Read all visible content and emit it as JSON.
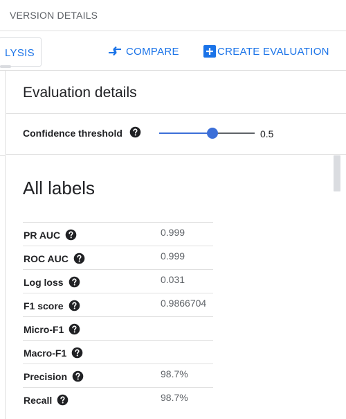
{
  "header": {
    "title": "VERSION DETAILS"
  },
  "toolbar": {
    "analysis_tab": "LYSIS",
    "compare_label": "COMPARE",
    "create_label": "CREATE EVALUATION"
  },
  "panel": {
    "title": "Evaluation details",
    "threshold": {
      "label": "Confidence threshold",
      "value": "0.5",
      "fraction": 0.5
    },
    "labels_heading": "All labels",
    "metrics": [
      {
        "name": "PR AUC",
        "value": "0.999"
      },
      {
        "name": "ROC AUC",
        "value": "0.999"
      },
      {
        "name": "Log loss",
        "value": "0.031"
      },
      {
        "name": "F1 score",
        "value": "0.9866704"
      },
      {
        "name": "Micro-F1",
        "value": ""
      },
      {
        "name": "Macro-F1",
        "value": ""
      },
      {
        "name": "Precision",
        "value": "98.7%"
      },
      {
        "name": "Recall",
        "value": "98.7%"
      }
    ]
  },
  "icons": {
    "compare": "compare-arrows-icon",
    "create": "add-box-icon",
    "help": "help-circle-icon"
  },
  "colors": {
    "accent": "#1a73e8",
    "slider": "#3c6fd8"
  }
}
